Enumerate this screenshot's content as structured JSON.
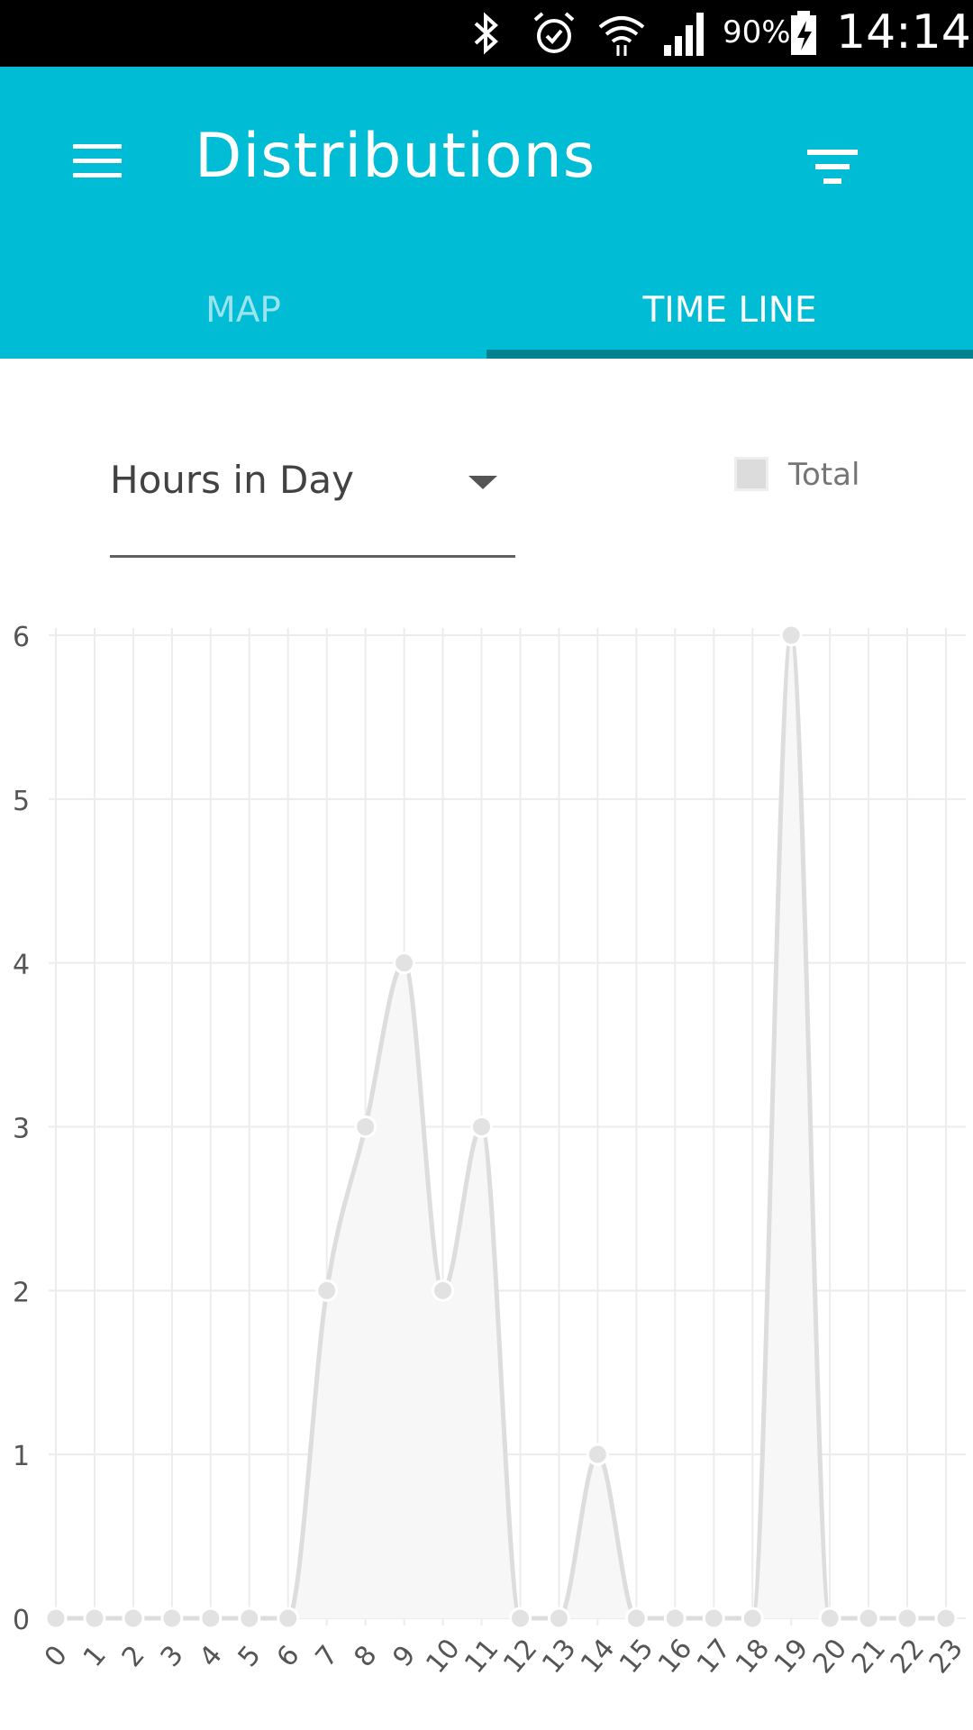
{
  "status_bar": {
    "battery": "90%",
    "time": "14:14",
    "icons": [
      "bluetooth-icon",
      "alarm-icon",
      "wifi-icon",
      "signal-icon",
      "battery-charging-icon"
    ]
  },
  "app_bar": {
    "title": "Distributions",
    "menu_icon": "menu-icon",
    "filter_icon": "filter-icon",
    "color": "#00BCD4",
    "indicator_color": "#00838F"
  },
  "tabs": [
    {
      "label": "MAP",
      "selected": false
    },
    {
      "label": "TIME LINE",
      "selected": true
    }
  ],
  "controls": {
    "dropdown_value": "Hours in Day",
    "legend_label": "Total"
  },
  "chart_data": {
    "type": "area",
    "categories": [
      "0",
      "1",
      "2",
      "3",
      "4",
      "5",
      "6",
      "7",
      "8",
      "9",
      "10",
      "11",
      "12",
      "13",
      "14",
      "15",
      "16",
      "17",
      "18",
      "19",
      "20",
      "21",
      "22",
      "23"
    ],
    "series": [
      {
        "name": "Total",
        "values": [
          0,
          0,
          0,
          0,
          0,
          0,
          0,
          2,
          3,
          4,
          2,
          3,
          0,
          0,
          1,
          0,
          0,
          0,
          0,
          6,
          0,
          0,
          0,
          0
        ]
      }
    ],
    "yticks": [
      "0",
      "1",
      "2",
      "3",
      "4",
      "5",
      "6"
    ],
    "ylim": [
      0,
      6
    ],
    "grid": true,
    "legend": "top-right",
    "line_color": "#dddddd",
    "fill_color": "#f7f7f7"
  }
}
